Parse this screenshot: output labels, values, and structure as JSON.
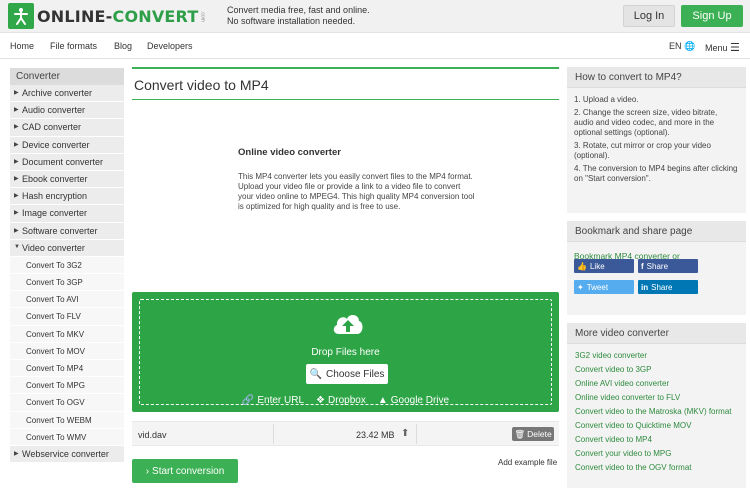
{
  "header": {
    "logo_main": "ONLINE-",
    "logo_accent": "CONVERT",
    "logo_suffix": ".com",
    "tagline_1": "Convert media free, fast and online.",
    "tagline_2": "No software installation needed.",
    "login_label": "Log In",
    "signup_label": "Sign Up"
  },
  "nav": {
    "items": [
      "Home",
      "File formats",
      "Blog",
      "Developers"
    ],
    "lang": "EN",
    "menu": "Menu"
  },
  "sidebar": {
    "title": "Converter",
    "items": [
      "Archive converter",
      "Audio converter",
      "CAD converter",
      "Device converter",
      "Document converter",
      "Ebook converter",
      "Hash encryption",
      "Image converter",
      "Software converter",
      "Video converter"
    ],
    "subitems": [
      "Convert To 3G2",
      "Convert To 3GP",
      "Convert To AVI",
      "Convert To FLV",
      "Convert To MKV",
      "Convert To MOV",
      "Convert To MP4",
      "Convert To MPG",
      "Convert To OGV",
      "Convert To WEBM",
      "Convert To WMV"
    ],
    "last_item": "Webservice converter"
  },
  "main": {
    "title": "Convert video to MP4",
    "intro_title": "Online video converter",
    "intro_text": "This MP4 converter lets you easily convert files to the MP4 format. Upload your video file or provide a link to a video file to convert your video online to MPEG4. This high quality MP4 conversion tool is optimized for high quality and is free to use.",
    "drop_label": "Drop Files here",
    "choose_label": "Choose Files",
    "sources": [
      "Enter URL",
      "Dropbox",
      "Google Drive"
    ],
    "file": {
      "name": "vid.dav",
      "size": "23.42 MB",
      "delete_label": "Delete"
    },
    "add_example": "Add example file",
    "start_label": "Start conversion"
  },
  "right": {
    "howto_title": "How to convert to MP4?",
    "howto_steps": [
      "1. Upload a video.",
      "2. Change the screen size, video bitrate, audio and video codec, and more in the optional settings (optional).",
      "3. Rotate, cut mirror or crop your video (optional).",
      "4. The conversion to MP4 begins after clicking on \"Start conversion\"."
    ],
    "bookmark_title": "Bookmark and share page",
    "bookmark_text": "Bookmark MP4 converter or",
    "share": {
      "like": "Like",
      "fb_share": "Share",
      "tweet": "Tweet",
      "in_share": "Share"
    },
    "more_title": "More video converter",
    "more_items": [
      "3G2 video converter",
      "Convert video to 3GP",
      "Online AVI video converter",
      "Online video converter to FLV",
      "Convert video to the Matroska (MKV) format",
      "Convert video to Quicktime MOV",
      "Convert video to MP4",
      "Convert your video to MPG",
      "Convert video to the OGV format"
    ]
  },
  "colors": {
    "accent": "#3cb054",
    "drop_bg": "#2da546",
    "link": "#2e8b3e",
    "facebook": "#3b5998",
    "twitter": "#55acee",
    "linkedin": "#0077b5"
  }
}
